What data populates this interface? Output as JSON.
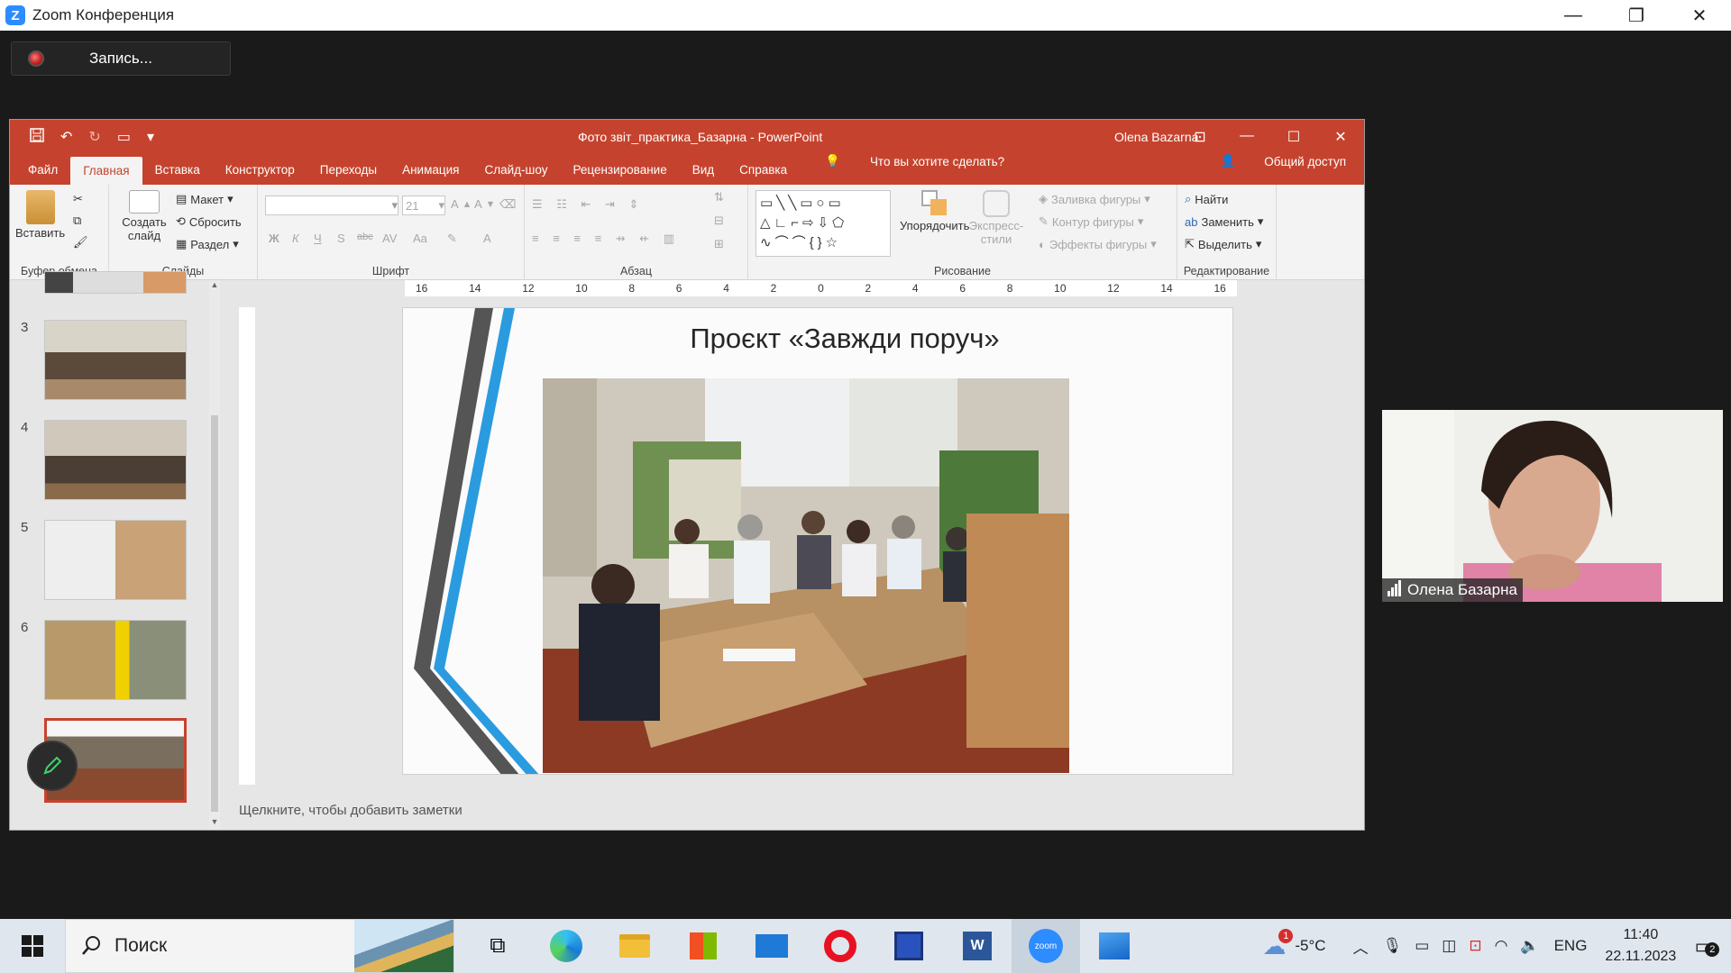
{
  "zoom": {
    "logo": "Z",
    "window_title": "Zoom Конференция",
    "controls": {
      "minimize": "—",
      "restore": "❐",
      "close": "✕"
    },
    "record_label": "Запись..."
  },
  "powerpoint": {
    "title": "Фото звіт_практика_Базарна  -  PowerPoint",
    "user": "Olena Bazarna",
    "quick_access": [
      "save-icon",
      "undo-icon",
      "redo-icon",
      "present-icon",
      "customize-icon"
    ],
    "controls": {
      "ribbon_display": "⊡",
      "minimize": "—",
      "maximize": "☐",
      "close": "✕"
    },
    "tabs": [
      "Файл",
      "Главная",
      "Вставка",
      "Конструктор",
      "Переходы",
      "Анимация",
      "Слайд-шоу",
      "Рецензирование",
      "Вид",
      "Справка"
    ],
    "active_tab": "Главная",
    "tell_me": "Что вы хотите сделать?",
    "share": "Общий доступ",
    "ribbon": {
      "clipboard": {
        "label": "Буфер обмена",
        "paste": "Вставить"
      },
      "slides": {
        "label": "Слайды",
        "new_slide": "Создать слайд",
        "layout": "Макет",
        "reset": "Сбросить",
        "section": "Раздел"
      },
      "font": {
        "label": "Шрифт",
        "font_name": "",
        "font_size": "21",
        "bold": "Ж",
        "italic": "К",
        "underline": "Ч",
        "shadow": "S",
        "strike": "abc",
        "spacing": "AV",
        "case": "Aa",
        "color": "A"
      },
      "paragraph": {
        "label": "Абзац"
      },
      "drawing": {
        "label": "Рисование",
        "arrange": "Упорядочить",
        "quick_styles": "Экспресс-стили",
        "fill": "Заливка фигуры",
        "outline": "Контур фигуры",
        "effects": "Эффекты фигуры"
      },
      "editing": {
        "label": "Редактирование",
        "find": "Найти",
        "replace": "Заменить",
        "select": "Выделить"
      }
    },
    "ruler_ticks": [
      "16",
      "14",
      "12",
      "10",
      "8",
      "6",
      "4",
      "2",
      "0",
      "2",
      "4",
      "6",
      "8",
      "10",
      "12",
      "14",
      "16"
    ],
    "thumbnails": [
      {
        "num": "3"
      },
      {
        "num": "4"
      },
      {
        "num": "5"
      },
      {
        "num": "6"
      },
      {
        "num": "7"
      }
    ],
    "slide": {
      "title": "Проєкт «Завжди поруч»"
    },
    "notes_placeholder": "Щелкните, чтобы добавить заметки"
  },
  "video": {
    "participant": "Олена Базарна"
  },
  "taskbar": {
    "search_placeholder": "Поиск",
    "apps": [
      "task-view",
      "edge",
      "explorer",
      "store",
      "mail",
      "opera",
      "save-app",
      "word",
      "zoom",
      "photos"
    ],
    "weather_badge": "1",
    "temperature": "-5°C",
    "language": "ENG",
    "time": "11:40",
    "date": "22.11.2023",
    "notification_count": "2"
  },
  "colors": {
    "ppt_accent": "#c5432e",
    "zoom_blue": "#2d8cff",
    "slide_blue": "#2b9be0"
  }
}
